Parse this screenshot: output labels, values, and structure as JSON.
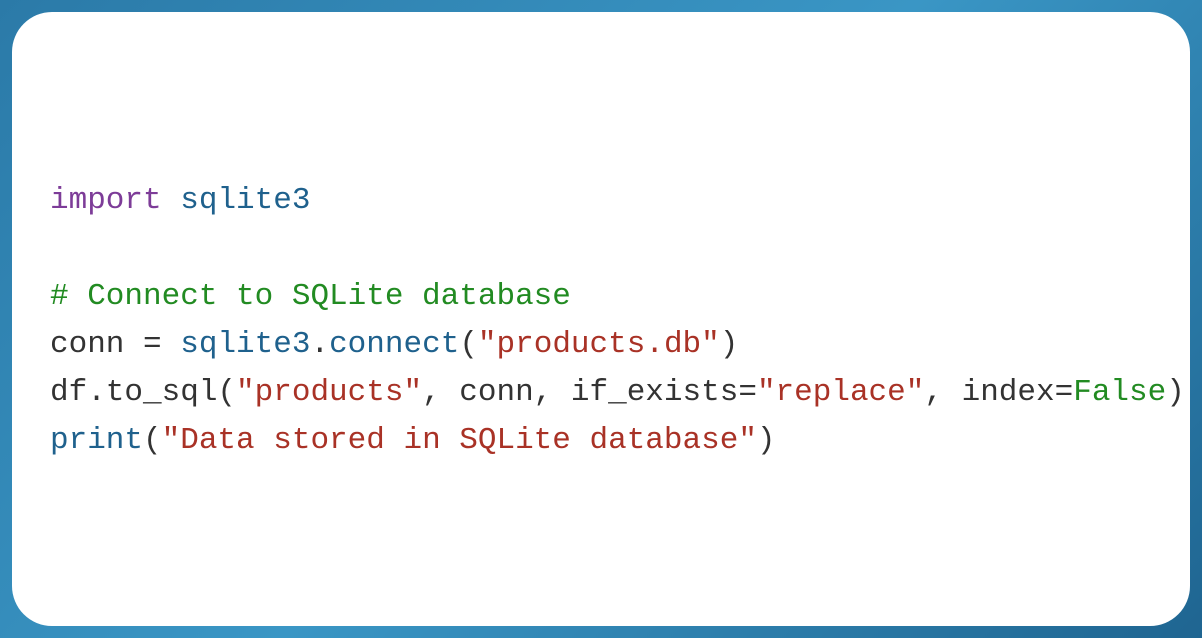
{
  "code": {
    "line1": {
      "import_kw": "import",
      "module": "sqlite3"
    },
    "line3_comment": "# Connect to SQLite database",
    "line4": {
      "var": "conn",
      "eq": " = ",
      "obj": "sqlite3",
      "dot": ".",
      "method": "connect",
      "open": "(",
      "str": "\"products.db\"",
      "close": ")"
    },
    "line5": {
      "prefix": "df.to_sql(",
      "str1": "\"products\"",
      "comma1": ", conn, ",
      "param1": "if_exists",
      "eq1": "=",
      "str2": "\"replace\"",
      "comma2": ", ",
      "param2": "index",
      "eq2": "=",
      "boolv": "False",
      "close": ")"
    },
    "line6": {
      "fn": "print",
      "open": "(",
      "str": "\"Data stored in SQLite database\"",
      "close": ")"
    }
  }
}
